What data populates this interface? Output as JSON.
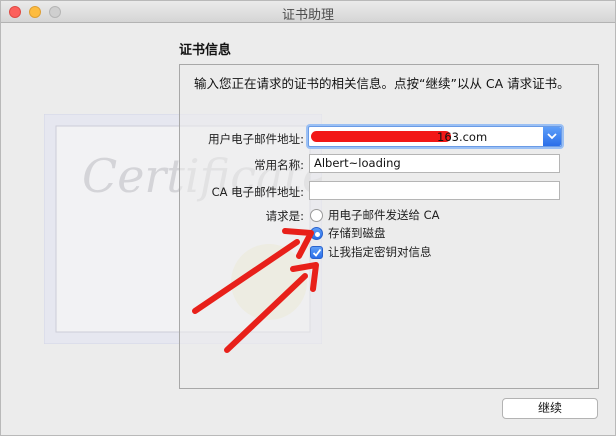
{
  "window": {
    "title": "证书助理"
  },
  "section": {
    "title": "证书信息"
  },
  "intro": "输入您正在请求的证书的相关信息。点按“继续”以从 CA 请求证书。",
  "form": {
    "email_label": "用户电子邮件地址:",
    "email_value": "163.com",
    "common_name_label": "常用名称:",
    "common_name_value": "Albert~loading",
    "ca_email_label": "CA 电子邮件地址:",
    "ca_email_value": "",
    "request_label": "请求是:",
    "option_email": "用电子邮件发送给 CA",
    "option_disk": "存储到磁盘",
    "option_keypair": "让我指定密钥对信息"
  },
  "state": {
    "selected_option": "disk",
    "keypair_checked": true
  },
  "buttons": {
    "continue": "继续"
  },
  "watermark": {
    "text": "Certificate"
  },
  "colors": {
    "accent": "#2a6ee9",
    "annotation_arrow": "#e8201a"
  },
  "icons": [
    "close-icon",
    "minimize-icon",
    "zoom-icon",
    "chevron-down-icon",
    "checkmark-icon",
    "annotation-arrow"
  ]
}
